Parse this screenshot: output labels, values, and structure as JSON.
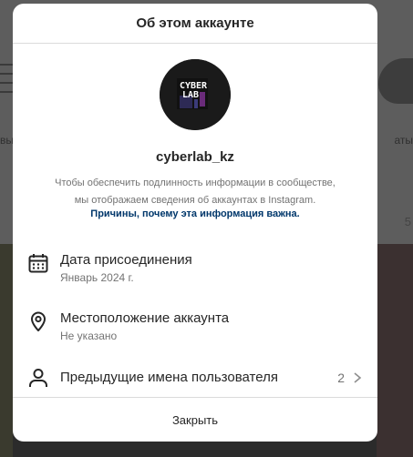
{
  "background": {
    "left_text": "вы",
    "right_text": "аты",
    "right_number": "5"
  },
  "modal": {
    "title": "Об этом аккаунте",
    "avatar": {
      "logo_line1": "CYBER",
      "logo_line2": "LAB"
    },
    "username": "cyberlab_kz",
    "description_line1": "Чтобы обеспечить подлинность информации в сообществе,",
    "description_line2": "мы отображаем сведения об аккаунтах в Instagram.",
    "reasons_link": "Причины, почему эта информация важна.",
    "rows": {
      "joined": {
        "icon": "calendar-icon",
        "title": "Дата присоединения",
        "value": "Январь 2024 г."
      },
      "location": {
        "icon": "location-pin-icon",
        "title": "Местоположение аккаунта",
        "value": "Не указано"
      },
      "former_usernames": {
        "icon": "user-icon",
        "title": "Предыдущие имена пользователя",
        "count": "2"
      }
    },
    "close_label": "Закрыть"
  },
  "colors": {
    "text_primary": "#262626",
    "text_secondary": "#737373",
    "link": "#00376b",
    "divider": "#dbdbdb"
  }
}
